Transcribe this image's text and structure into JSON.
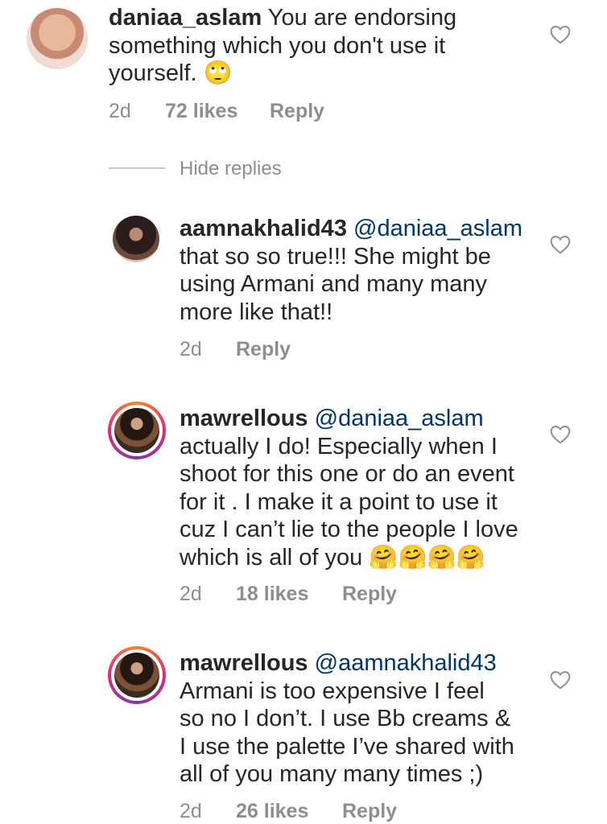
{
  "comments": [
    {
      "username": "daniaa_aslam",
      "text_lines": [
        "You are endorsing",
        "something which you don't use it",
        "yourself. 🙄"
      ],
      "time": "2d",
      "likes": "72 likes",
      "reply": "Reply"
    },
    {
      "username": "aamnakhalid43",
      "mention": "@daniaa_aslam",
      "text_lines": [
        "that so so true!!! She might be",
        "using Armani and many many",
        "more like that!!"
      ],
      "time": "2d",
      "reply": "Reply"
    },
    {
      "username": "mawrellous",
      "mention": "@daniaa_aslam",
      "text_lines": [
        "actually I do! Especially when I",
        "shoot for this one or do an event",
        "for it . I make it a point to use it",
        "cuz I can’t lie to the people I love",
        "which is all of you"
      ],
      "emoji": "🤗🤗🤗🤗",
      "time": "2d",
      "likes": "18 likes",
      "reply": "Reply"
    },
    {
      "username": "mawrellous",
      "mention": "@aamnakhalid43",
      "text_lines": [
        "Armani is too expensive I feel",
        "so no I don’t. I use Bb creams &",
        "I use the palette I’ve shared with",
        "all of you many many times ;)"
      ],
      "time": "2d",
      "likes": "26 likes",
      "reply": "Reply"
    }
  ],
  "hide_replies": "Hide replies",
  "icons": {
    "like": "heart-outline-icon",
    "eyeroll": "face-with-rolling-eyes-emoji",
    "hug": "hugging-face-emoji"
  }
}
